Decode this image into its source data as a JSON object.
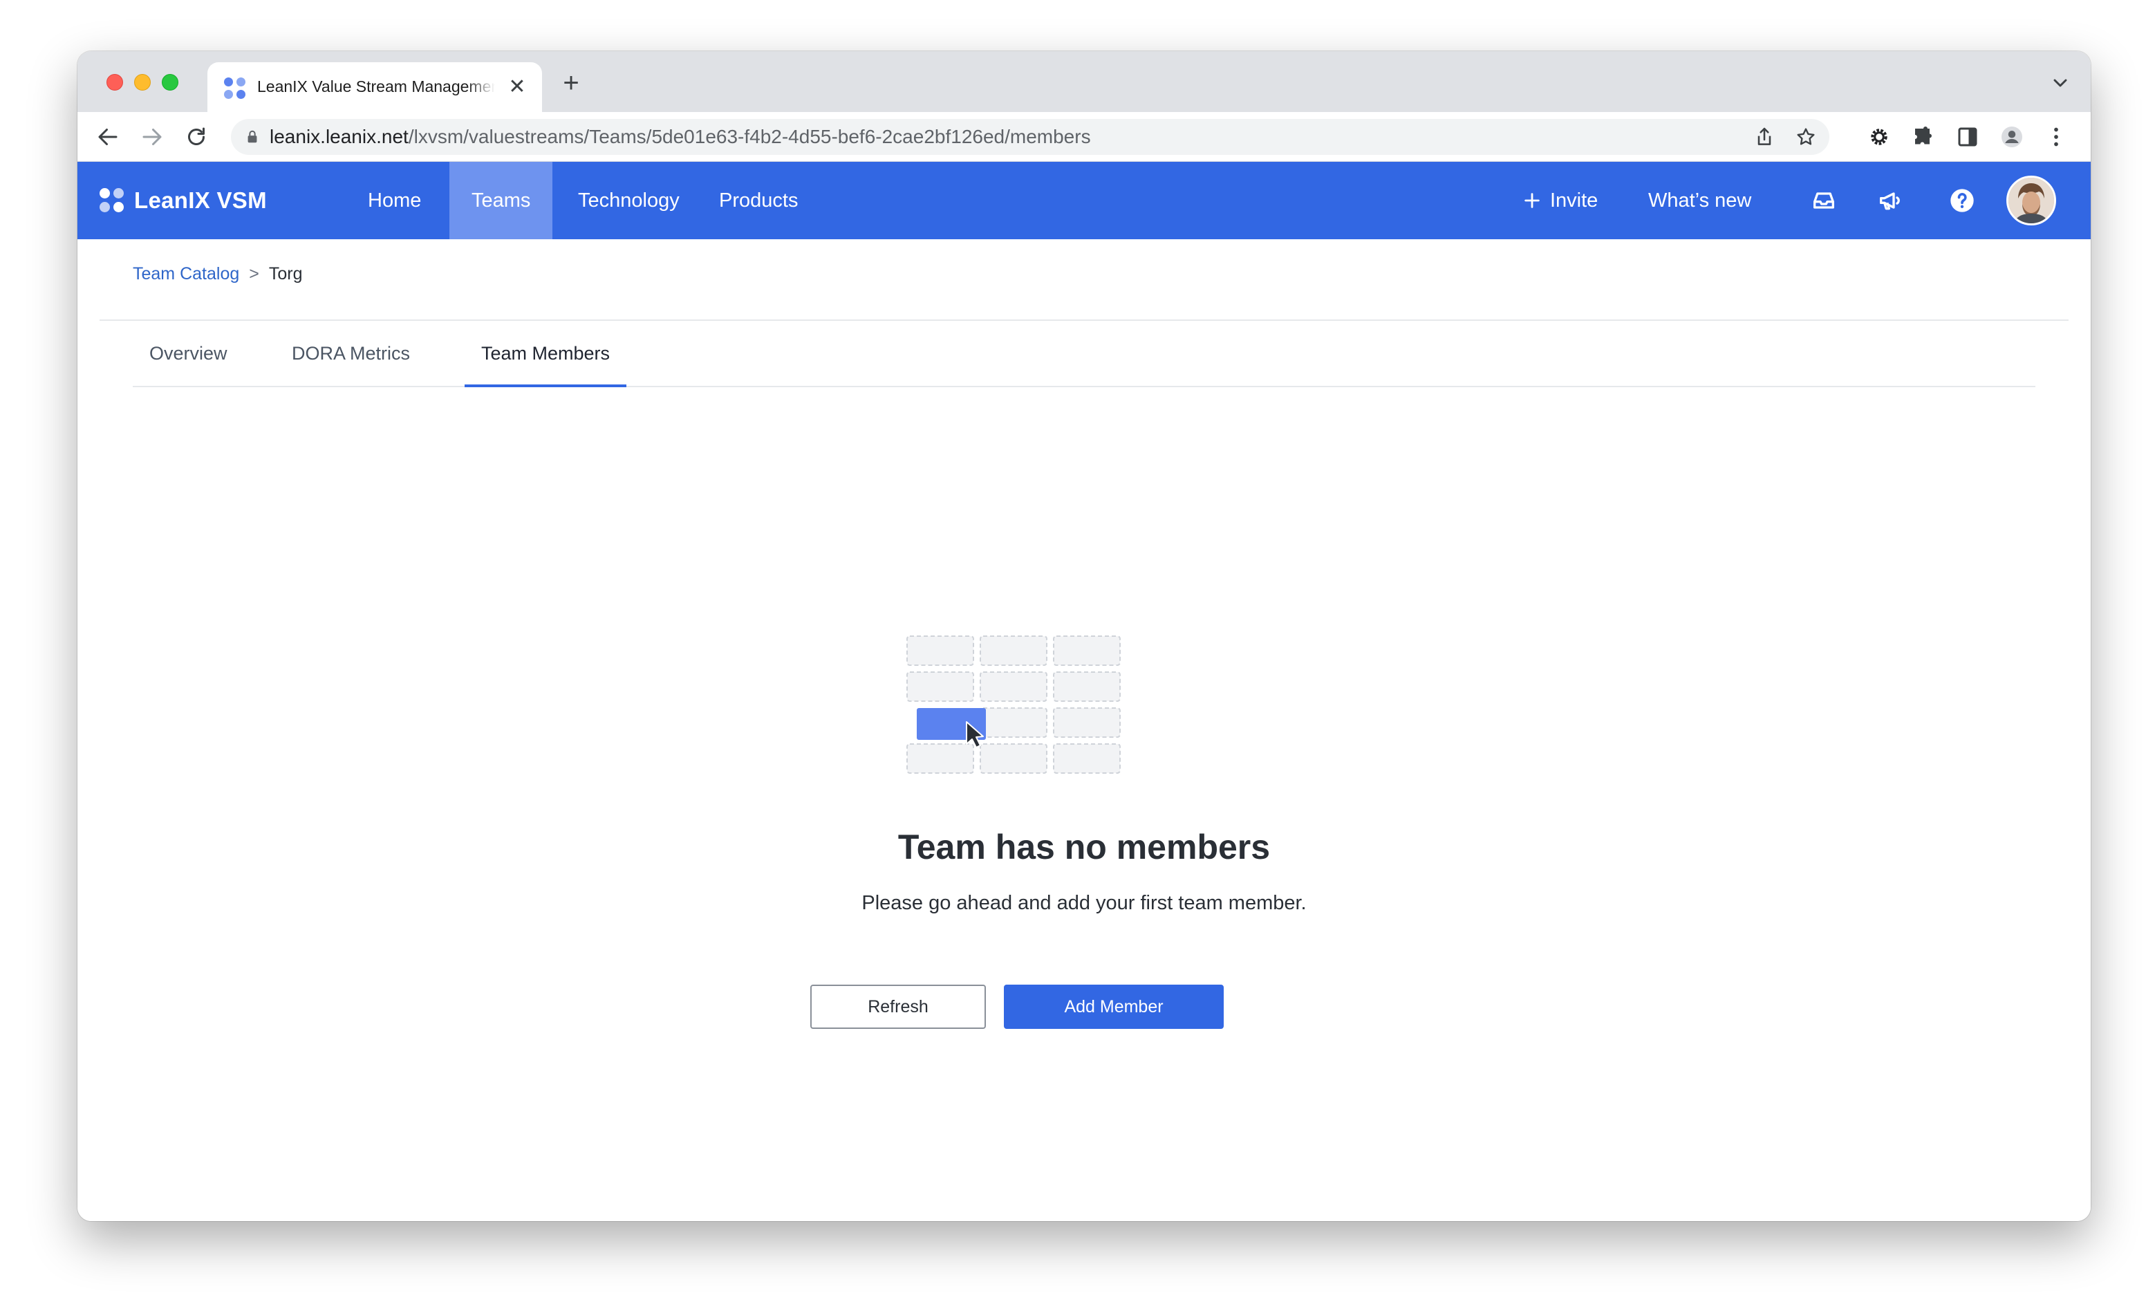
{
  "browser": {
    "tab_title": "LeanIX Value Stream Management",
    "new_tab_symbol": "+",
    "tab_close_symbol": "✕",
    "url_domain": "leanix.leanix.net",
    "url_path": "/lxvsm/valuestreams/Teams/5de01e63-f4b2-4d55-bef6-2cae2bf126ed/members"
  },
  "app": {
    "logo_text": "LeanIX VSM",
    "nav": [
      {
        "label": "Home",
        "active": false
      },
      {
        "label": "Teams",
        "active": true
      },
      {
        "label": "Technology",
        "active": false
      },
      {
        "label": "Products",
        "active": false
      }
    ],
    "invite_label": "Invite",
    "whats_new_label": "What’s new"
  },
  "breadcrumb": {
    "parent": "Team Catalog",
    "separator": ">",
    "current": "Torg"
  },
  "tabs": [
    {
      "label": "Overview",
      "active": false
    },
    {
      "label": "DORA Metrics",
      "active": false
    },
    {
      "label": "Team Members",
      "active": true
    }
  ],
  "empty_state": {
    "title": "Team has no members",
    "subtitle": "Please go ahead and add your first team member.",
    "refresh_label": "Refresh",
    "add_member_label": "Add Member"
  },
  "colors": {
    "brand_blue": "#3267e3",
    "active_nav": "#6e93ef"
  }
}
